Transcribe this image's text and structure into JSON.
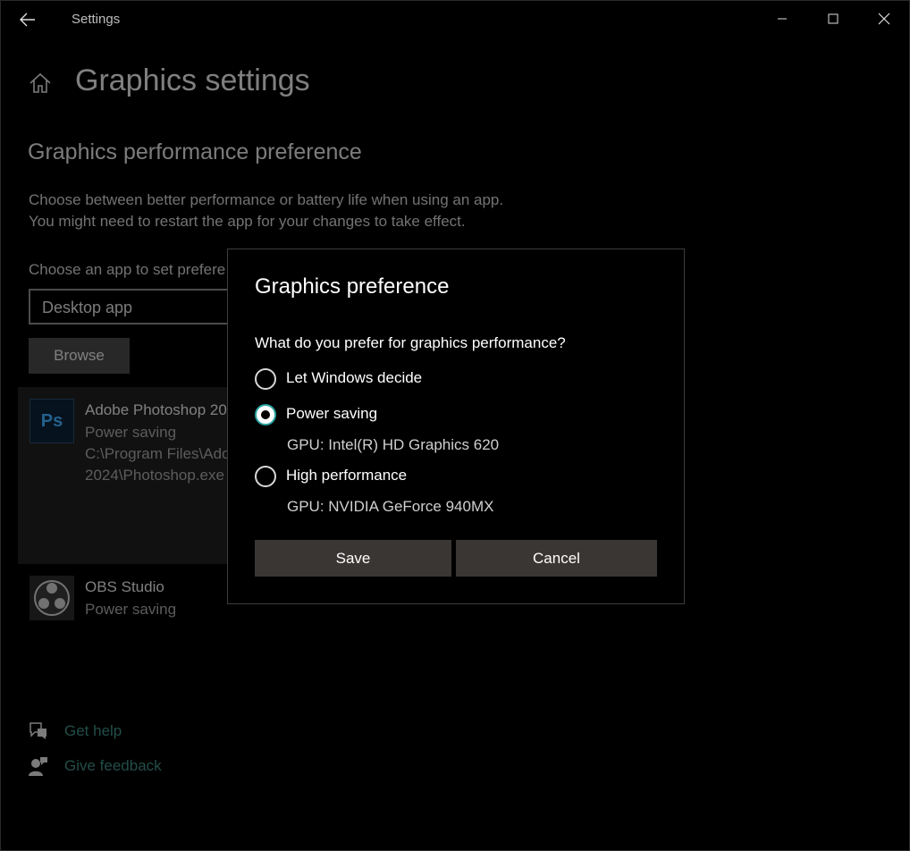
{
  "window": {
    "title": "Settings"
  },
  "page": {
    "title": "Graphics settings",
    "section_title": "Graphics performance preference",
    "description_line1": "Choose between better performance or battery life when using an app.",
    "description_line2": "You might need to restart the app for your changes to take effect.",
    "choose_label": "Choose an app to set prefere",
    "app_type_value": "Desktop app",
    "browse_label": "Browse"
  },
  "apps": [
    {
      "name": "Adobe Photoshop 20",
      "preference": "Power saving",
      "path_line1": "C:\\Program Files\\Ado",
      "path_line2": "2024\\Photoshop.exe",
      "icon": "photoshop-icon",
      "icon_text": "Ps"
    },
    {
      "name": "OBS Studio",
      "preference": "Power saving",
      "icon": "obs-icon"
    }
  ],
  "help": {
    "get_help": "Get help",
    "give_feedback": "Give feedback"
  },
  "dialog": {
    "title": "Graphics preference",
    "question": "What do you prefer for graphics performance?",
    "options": [
      {
        "label": "Let Windows decide",
        "selected": false
      },
      {
        "label": "Power saving",
        "selected": true,
        "gpu": "GPU: Intel(R) HD Graphics 620"
      },
      {
        "label": "High performance",
        "selected": false,
        "gpu": "GPU: NVIDIA GeForce 940MX"
      }
    ],
    "save_label": "Save",
    "cancel_label": "Cancel"
  },
  "colors": {
    "accent": "#2aa3a0",
    "link": "#3f8e83",
    "dialog_button": "#3a3634"
  }
}
